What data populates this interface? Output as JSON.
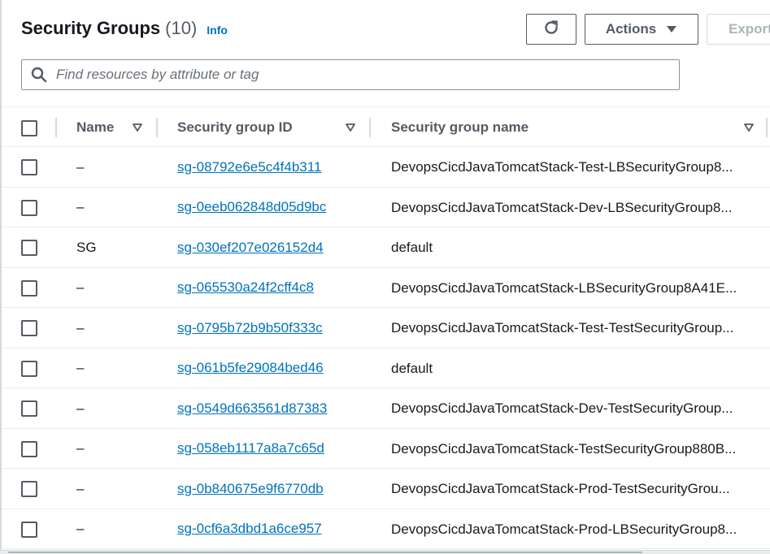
{
  "header": {
    "title": "Security Groups",
    "count": "(10)",
    "info_label": "Info"
  },
  "toolbar": {
    "refresh_icon": "refresh-icon",
    "actions_label": "Actions",
    "actions_caret_icon": "caret-down-icon",
    "export_label": "Export"
  },
  "search": {
    "placeholder": "Find resources by attribute or tag",
    "value": "",
    "icon": "search-icon"
  },
  "table": {
    "columns": [
      {
        "label": "Name"
      },
      {
        "label": "Security group ID"
      },
      {
        "label": "Security group name"
      }
    ],
    "rows": [
      {
        "name": "–",
        "id": "sg-08792e6e5c4f4b311",
        "sg_name": "DevopsCicdJavaTomcatStack-Test-LBSecurityGroup8..."
      },
      {
        "name": "–",
        "id": "sg-0eeb062848d05d9bc",
        "sg_name": "DevopsCicdJavaTomcatStack-Dev-LBSecurityGroup8..."
      },
      {
        "name": "SG",
        "id": "sg-030ef207e026152d4",
        "sg_name": "default"
      },
      {
        "name": "–",
        "id": "sg-065530a24f2cff4c8",
        "sg_name": "DevopsCicdJavaTomcatStack-LBSecurityGroup8A41E..."
      },
      {
        "name": "–",
        "id": "sg-0795b72b9b50f333c",
        "sg_name": "DevopsCicdJavaTomcatStack-Test-TestSecurityGroup..."
      },
      {
        "name": "–",
        "id": "sg-061b5fe29084bed46",
        "sg_name": "default"
      },
      {
        "name": "–",
        "id": "sg-0549d663561d87383",
        "sg_name": "DevopsCicdJavaTomcatStack-Dev-TestSecurityGroup..."
      },
      {
        "name": "–",
        "id": "sg-058eb1117a8a7c65d",
        "sg_name": "DevopsCicdJavaTomcatStack-TestSecurityGroup880B..."
      },
      {
        "name": "–",
        "id": "sg-0b840675e9f6770db",
        "sg_name": "DevopsCicdJavaTomcatStack-Prod-TestSecurityGrou..."
      },
      {
        "name": "–",
        "id": "sg-0cf6a3dbd1a6ce957",
        "sg_name": "DevopsCicdJavaTomcatStack-Prod-LBSecurityGroup8..."
      }
    ]
  },
  "colors": {
    "link": "#0073bb",
    "text": "#16191f",
    "muted": "#545b64",
    "border": "#eaeded"
  }
}
